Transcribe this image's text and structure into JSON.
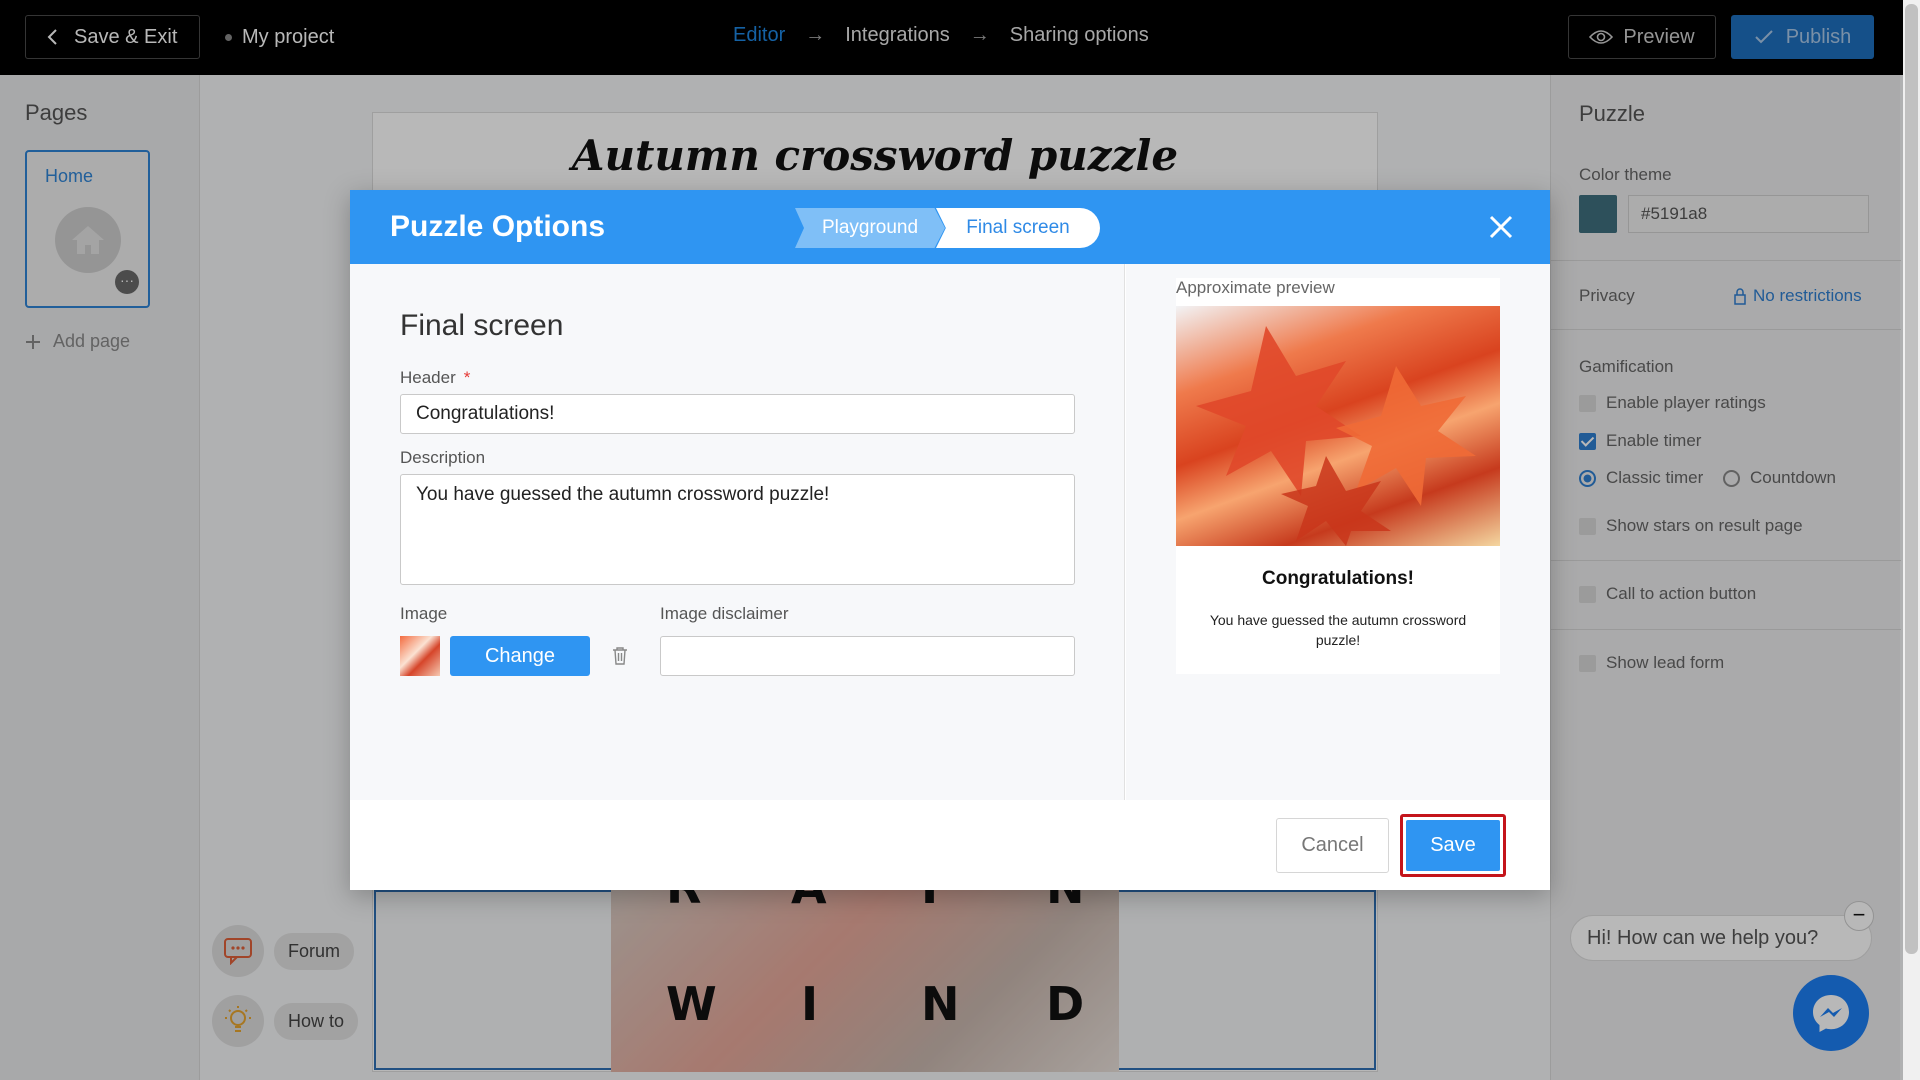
{
  "topbar": {
    "save_exit": "Save & Exit",
    "project": "My project",
    "steps": [
      "Editor",
      "Integrations",
      "Sharing options"
    ],
    "preview": "Preview",
    "publish": "Publish"
  },
  "pages": {
    "title": "Pages",
    "home": "Home",
    "add_page": "Add page"
  },
  "canvas": {
    "title": "Autumn crossword puzzle",
    "row1": [
      "R",
      "A",
      "I",
      "N"
    ],
    "row2": [
      "W",
      "I",
      "N",
      "D"
    ]
  },
  "right_panel": {
    "title": "Puzzle",
    "color_theme_label": "Color theme",
    "color_theme_value": "#5191a8",
    "privacy_label": "Privacy",
    "privacy_value": "No restrictions",
    "gamification_label": "Gamification",
    "enable_player_ratings": "Enable player ratings",
    "enable_timer": "Enable timer",
    "classic_timer": "Classic timer",
    "countdown": "Countdown",
    "show_stars": "Show stars on result page",
    "cta_button": "Call to action button",
    "lead_form": "Show lead form"
  },
  "helpers": {
    "forum": "Forum",
    "how_to": "How to"
  },
  "chat": {
    "greeting": "Hi! How can we help you?"
  },
  "modal": {
    "title": "Puzzle Options",
    "tabs": [
      "Playground",
      "Final screen"
    ],
    "section_title": "Final screen",
    "header_label": "Header",
    "header_value": "Congratulations!",
    "description_label": "Description",
    "description_value": "You have guessed the autumn crossword puzzle!",
    "image_label": "Image",
    "change_button": "Change",
    "disclaimer_label": "Image disclaimer",
    "disclaimer_value": "",
    "preview_label": "Approximate preview",
    "preview_header": "Congratulations!",
    "preview_description": "You have guessed the autumn crossword puzzle!",
    "cancel": "Cancel",
    "save": "Save"
  },
  "colors": {
    "accent": "#2f95f2",
    "theme": "#5191a8",
    "highlight": "#c4141b"
  }
}
